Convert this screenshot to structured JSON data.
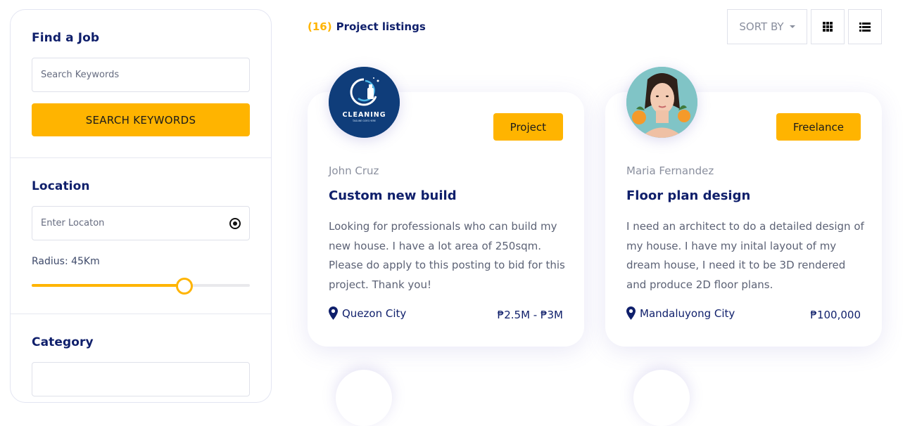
{
  "sidebar": {
    "find_job": {
      "heading": "Find a Job",
      "placeholder": "Search Keywords",
      "button": "SEARCH KEYWORDS"
    },
    "location": {
      "heading": "Location",
      "placeholder": "Enter Locaton",
      "radius_label": "Radius: 45Km",
      "radius_fraction": 0.7
    },
    "category": {
      "heading": "Category"
    }
  },
  "listing": {
    "count": "(16)",
    "label": "Project listings"
  },
  "toolbar": {
    "sort_label": "SORT BY",
    "grid_icon": "grid-icon",
    "list_icon": "list-icon"
  },
  "colors": {
    "accent": "#ffb400",
    "navy": "#0f1f6b"
  },
  "cards": [
    {
      "avatar": "cleaning-logo",
      "logo_text": "CLEANING",
      "logo_tagline": "TAGLINE GOES HERE",
      "tag": "Project",
      "author": "John Cruz",
      "title": "Custom new build",
      "description": "Looking for professionals who can build my new house. I have a lot area of 250sqm. Please do apply to this posting to bid for this project. Thank you!",
      "location": "Quezon City",
      "price": "₱2.5M - ₱3M"
    },
    {
      "avatar": "woman-portrait",
      "tag": "Freelance",
      "author": "Maria Fernandez",
      "title": "Floor plan design",
      "description": "I need an architect to do a detailed design of my house. I have my inital layout of my dream house, I need it to be 3D rendered and produce 2D floor plans.",
      "location": "Mandaluyong City",
      "price": "₱100,000"
    }
  ]
}
